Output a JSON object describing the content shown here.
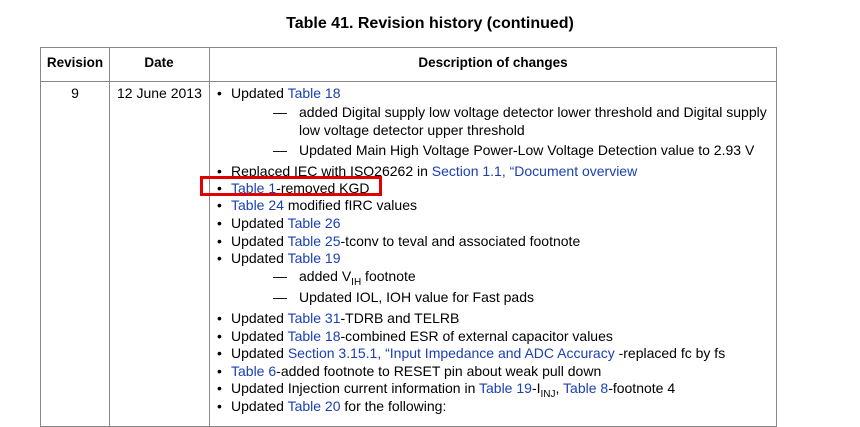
{
  "title": "Table 41. Revision history (continued)",
  "headers": {
    "revision": "Revision",
    "date": "Date",
    "description": "Description of changes"
  },
  "row": {
    "revision": "9",
    "date": "12 June 2013"
  },
  "lines": {
    "l1_pre": "Updated ",
    "l1_link": "Table 18",
    "l2": "added Digital supply low voltage detector lower threshold and Digital supply",
    "l3": "low voltage detector upper threshold",
    "l4": "Updated Main High Voltage Power-Low Voltage Detection value to 2.93 V",
    "l5_pre": "Replaced IEC with ISO26262 in ",
    "l5_link": "Section 1.1, “Document overview",
    "l6_link": "Table 1",
    "l6_post": "-removed KGD",
    "l7_link": "Table 24",
    "l7_post": " modified fIRC values",
    "l8_pre": "Updated ",
    "l8_link": "Table 26",
    "l9_pre": "Updated ",
    "l9_link": "Table 25",
    "l9_post": "-tconv to teval and associated footnote",
    "l10_pre": "Updated ",
    "l10_link": "Table 19",
    "l11_pre": "added V",
    "l11_sub": "IH",
    "l11_post": " footnote",
    "l12": "Updated IOL, IOH value for Fast pads",
    "l13_pre": "Updated ",
    "l13_link": "Table 31",
    "l13_post": "-TDRB and TELRB",
    "l14_pre": "Updated ",
    "l14_link": "Table 18",
    "l14_post": "-combined ESR of external capacitor values",
    "l15_pre": "Updated ",
    "l15_link": "Section 3.15.1, “Input Impedance and ADC Accuracy",
    "l15_post": " -replaced fc by fs",
    "l16_link": "Table 6",
    "l16_post": "-added footnote to RESET pin about weak pull down",
    "l17_pre": "Updated Injection current information in ",
    "l17_link": "Table 19",
    "l17_mid": "-I",
    "l17_sub": "INJ",
    "l17_sep": ", ",
    "l17_link2": "Table 8",
    "l17_post": "-footnote 4",
    "l18_pre": "Updated ",
    "l18_link": "Table 20",
    "l18_post": " for the following:"
  },
  "bullet": "•",
  "dash": "—",
  "colors": {
    "link": "#1a3fb4",
    "highlight": "#e00000",
    "border": "#888888"
  }
}
